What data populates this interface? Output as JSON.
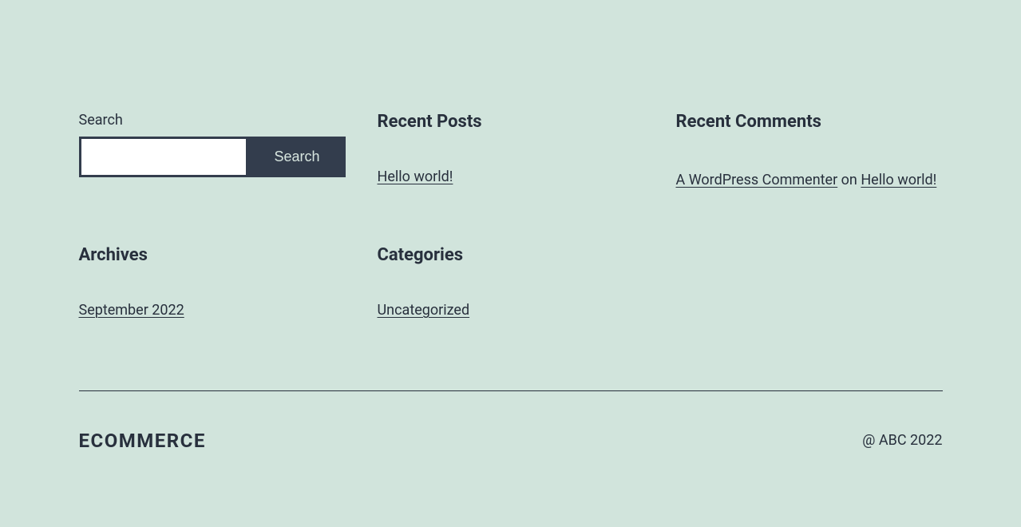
{
  "search": {
    "label": "Search",
    "button": "Search",
    "value": ""
  },
  "recent_posts": {
    "heading": "Recent Posts",
    "items": [
      {
        "label": "Hello world!"
      }
    ]
  },
  "recent_comments": {
    "heading": "Recent Comments",
    "items": [
      {
        "author": "A WordPress Commenter",
        "on_text": " on ",
        "post": "Hello world!"
      }
    ]
  },
  "archives": {
    "heading": "Archives",
    "items": [
      {
        "label": "September 2022"
      }
    ]
  },
  "categories": {
    "heading": "Categories",
    "items": [
      {
        "label": "Uncategorized"
      }
    ]
  },
  "footer": {
    "site_title": "ECOMMERCE",
    "copyright": "@ ABC 2022"
  }
}
